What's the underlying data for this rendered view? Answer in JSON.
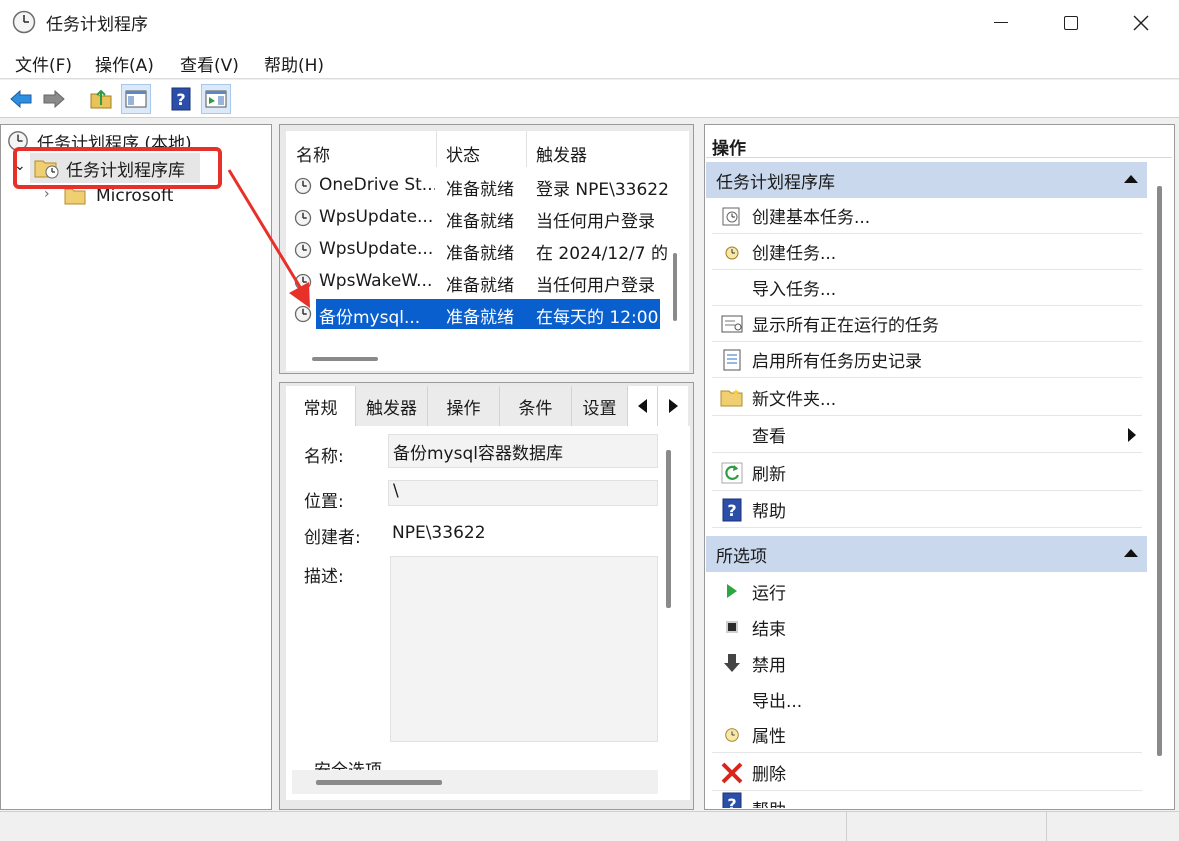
{
  "window": {
    "title": "任务计划程序",
    "controls": [
      "minimize-icon",
      "maximize-icon",
      "close-icon"
    ]
  },
  "menu": {
    "items": [
      "文件(F)",
      "操作(A)",
      "查看(V)",
      "帮助(H)"
    ]
  },
  "toolbar": {
    "buttons": [
      "back-arrow-icon",
      "forward-arrow-icon",
      "up-folder-icon",
      "show-hide-console-tree-icon",
      "help-icon",
      "show-hide-action-pane-icon"
    ]
  },
  "tree": {
    "root": "任务计划程序 (本地)",
    "library": "任务计划程序库",
    "child": "Microsoft"
  },
  "task_list": {
    "headers": [
      "名称",
      "状态",
      "触发器"
    ],
    "rows": [
      {
        "name": "OneDrive St...",
        "status": "准备就绪",
        "trigger": "登录 NPE\\33622"
      },
      {
        "name": "WpsUpdate...",
        "status": "准备就绪",
        "trigger": "当任何用户登录"
      },
      {
        "name": "WpsUpdate...",
        "status": "准备就绪",
        "trigger": "在 2024/12/7 的"
      },
      {
        "name": "WpsWakeW...",
        "status": "准备就绪",
        "trigger": "当任何用户登录"
      },
      {
        "name": "备份mysql...",
        "status": "准备就绪",
        "trigger": "在每天的 12:00"
      }
    ],
    "selected_index": 4
  },
  "detail": {
    "tabs": [
      "常规",
      "触发器",
      "操作",
      "条件",
      "设置"
    ],
    "active_tab": "常规",
    "labels": {
      "name": "名称:",
      "location": "位置:",
      "author": "创建者:",
      "description": "描述:",
      "security": "安全选项"
    },
    "values": {
      "name": "备份mysql容器数据库",
      "location": "\\",
      "author": "NPE\\33622",
      "description": ""
    }
  },
  "actions": {
    "pane_title": "操作",
    "section1": {
      "title": "任务计划程序库",
      "items": [
        "创建基本任务...",
        "创建任务...",
        "导入任务...",
        "显示所有正在运行的任务",
        "启用所有任务历史记录",
        "新文件夹...",
        "查看",
        "刷新",
        "帮助"
      ]
    },
    "section2": {
      "title": "所选项",
      "items": [
        "运行",
        "结束",
        "禁用",
        "导出...",
        "属性",
        "删除",
        "帮助"
      ]
    }
  },
  "colors": {
    "selection": "#0a5fcf",
    "section_header": "#c9d8ed",
    "annotation_red": "#e8302a"
  }
}
